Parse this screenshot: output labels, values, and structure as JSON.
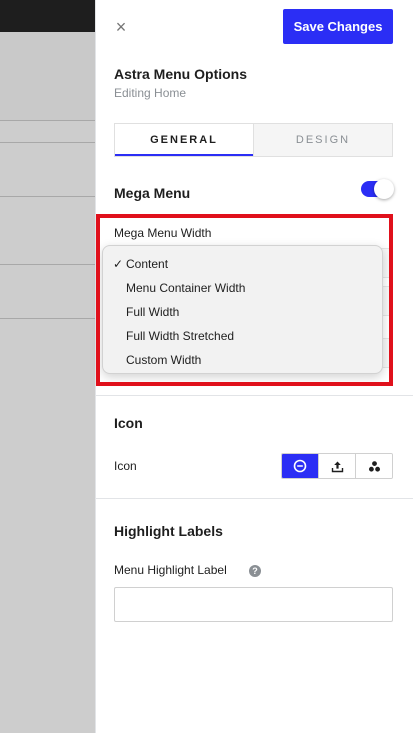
{
  "header": {
    "close_glyph": "×",
    "save_label": "Save Changes"
  },
  "panel": {
    "title": "Astra Menu Options",
    "subtitle": "Editing Home"
  },
  "tabs": [
    {
      "label": "GENERAL",
      "active": true
    },
    {
      "label": "DESIGN",
      "active": false
    }
  ],
  "mega_menu": {
    "title": "Mega Menu",
    "enabled": true,
    "width_label": "Mega Menu Width",
    "options": [
      {
        "label": "Content",
        "selected": true
      },
      {
        "label": "Menu Container Width",
        "selected": false
      },
      {
        "label": "Full Width",
        "selected": false
      },
      {
        "label": "Full Width Stretched",
        "selected": false
      },
      {
        "label": "Custom Width",
        "selected": false
      }
    ],
    "check_glyph": "✓"
  },
  "icon_section": {
    "title": "Icon",
    "label": "Icon",
    "buttons": [
      {
        "icon": "minus-circle-icon",
        "active": true
      },
      {
        "icon": "upload-icon",
        "active": false
      },
      {
        "icon": "dashicons-icon",
        "active": false
      }
    ]
  },
  "highlight": {
    "title": "Highlight Labels",
    "label": "Menu Highlight Label",
    "help_glyph": "?",
    "value": ""
  },
  "colors": {
    "accent": "#2b2ef5",
    "annotation_red": "#e0101b"
  }
}
